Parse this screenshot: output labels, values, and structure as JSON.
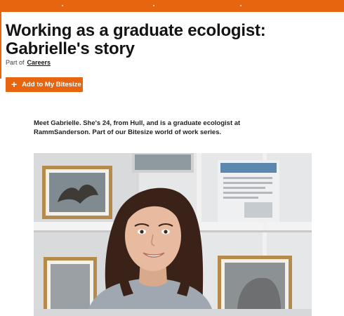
{
  "header": {
    "accent_color": "#e8650f"
  },
  "article": {
    "title": "Working as a graduate ecologist: Gabrielle's story",
    "part_of_label": "Part of",
    "part_of_link": "Careers",
    "add_button_label": "Add to My Bitesize",
    "add_button_icon": "plus-icon",
    "intro": "Meet Gabrielle. She's 24, from Hull, and is a graduate ecologist at RammSanderson. Part of our Bitesize world of work series."
  }
}
